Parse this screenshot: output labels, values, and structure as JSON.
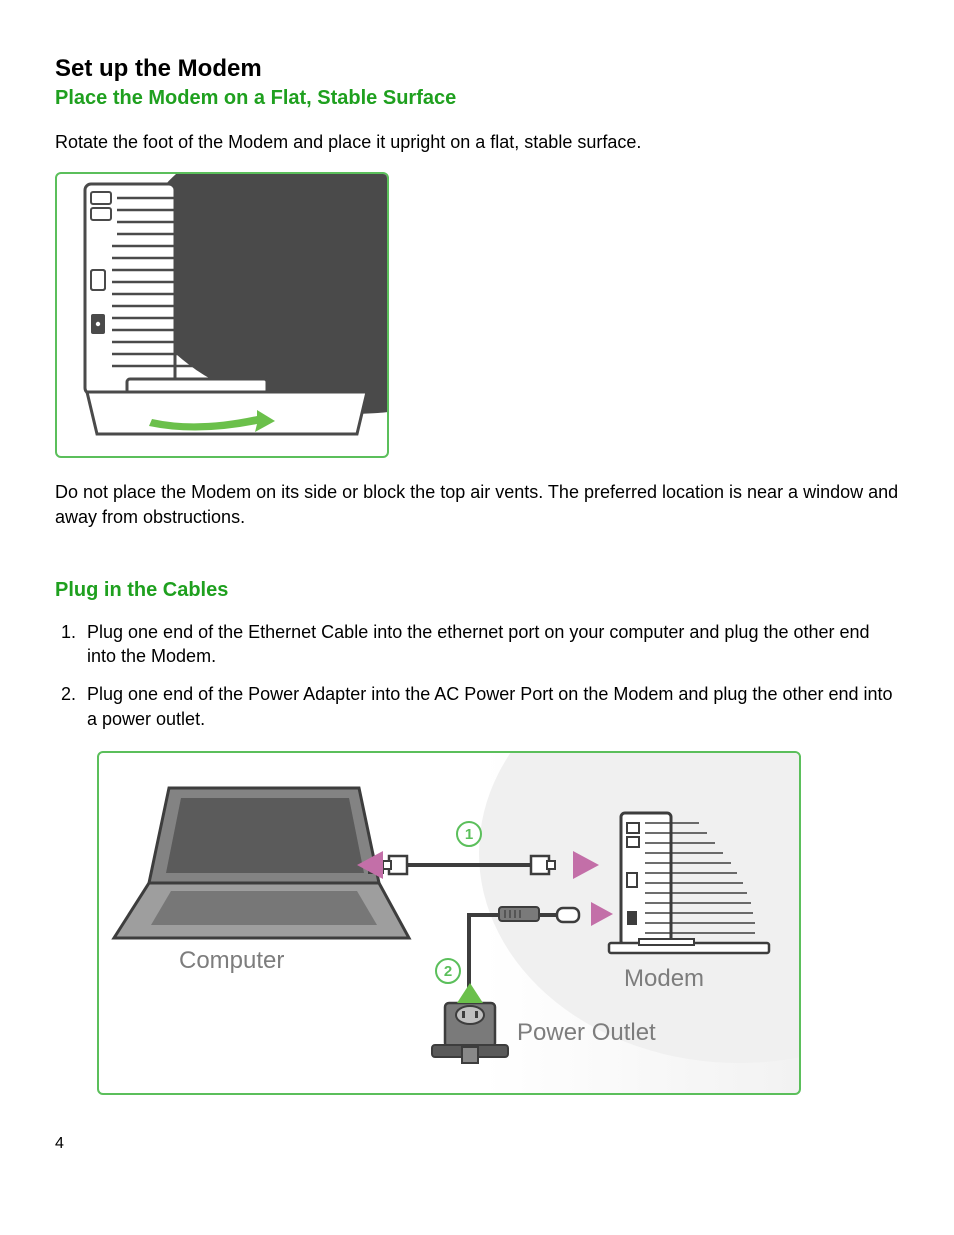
{
  "headings": {
    "h1": "Set up the Modem",
    "h2a": "Place the Modem on a Flat, Stable Surface",
    "h2b": "Plug in the Cables"
  },
  "paragraphs": {
    "intro": "Rotate the foot of the Modem and place it upright on a flat, stable surface.",
    "warning": "Do not place the Modem on its side or block the top air vents.  The preferred location is near a window and away from obstructions."
  },
  "steps": {
    "s1": "Plug one end of the Ethernet Cable into the ethernet port on your computer and plug the other end into the Modem.",
    "s2": "Plug one end of the Power Adapter into the AC Power Port on the Modem and plug the other end into a power outlet."
  },
  "figure2": {
    "label_computer": "Computer",
    "label_modem": "Modem",
    "label_outlet": "Power Outlet",
    "step1": "1",
    "step2": "2"
  },
  "page_number": "4"
}
